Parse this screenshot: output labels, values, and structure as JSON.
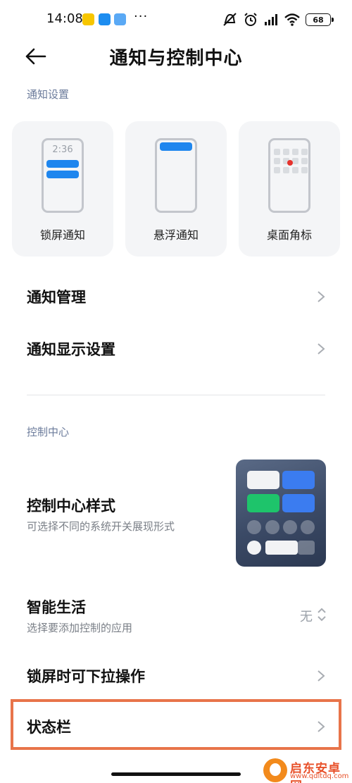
{
  "status_bar": {
    "time": "14:08",
    "dots": "···",
    "battery": "68",
    "app_icons": [
      "meituan-icon",
      "feishu-icon",
      "cloud-icon"
    ]
  },
  "header": {
    "title": "通知与控制中心"
  },
  "notification_settings": {
    "section_label": "通知设置",
    "cards": [
      {
        "label": "锁屏通知",
        "preview_time": "2:36"
      },
      {
        "label": "悬浮通知"
      },
      {
        "label": "桌面角标"
      }
    ],
    "rows": [
      {
        "title": "通知管理"
      },
      {
        "title": "通知显示设置"
      }
    ]
  },
  "control_center": {
    "section_label": "控制中心",
    "style_row": {
      "title": "控制中心样式",
      "subtitle": "可选择不同的系统开关展现形式"
    },
    "smart_life_row": {
      "title": "智能生活",
      "subtitle": "选择要添加控制的应用",
      "value": "无"
    },
    "lockscreen_pulldown_row": {
      "title": "锁屏时可下拉操作"
    },
    "status_bar_row": {
      "title": "状态栏"
    }
  },
  "watermark": {
    "name": "启东安卓网",
    "url": "www.qdltdq.com"
  },
  "colors": {
    "accent_blue": "#1f86ee",
    "highlight_orange": "#e8744a",
    "section_label": "#6b7b9b"
  }
}
